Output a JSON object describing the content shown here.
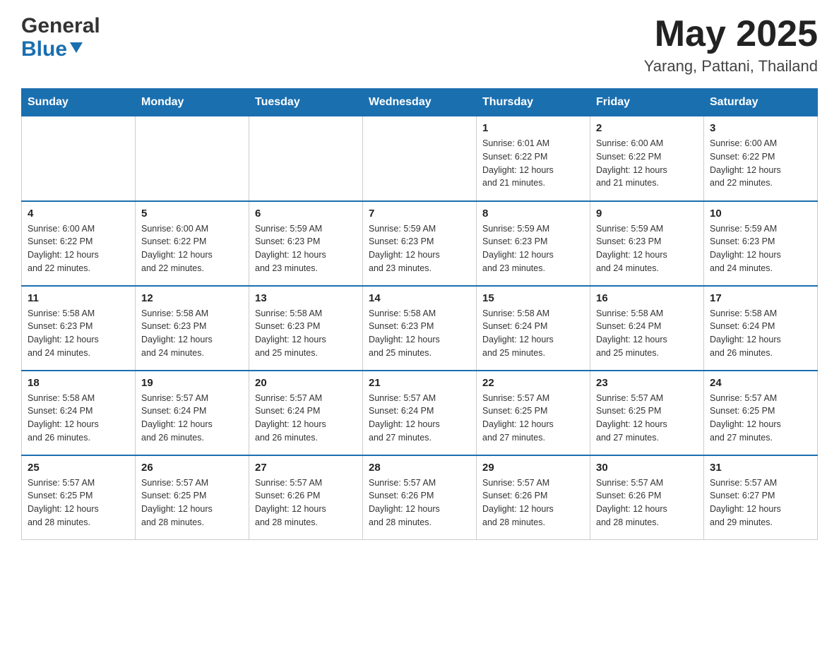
{
  "header": {
    "logo_general": "General",
    "logo_blue": "Blue",
    "month_title": "May 2025",
    "location": "Yarang, Pattani, Thailand"
  },
  "weekdays": [
    "Sunday",
    "Monday",
    "Tuesday",
    "Wednesday",
    "Thursday",
    "Friday",
    "Saturday"
  ],
  "weeks": [
    [
      {
        "day": "",
        "info": ""
      },
      {
        "day": "",
        "info": ""
      },
      {
        "day": "",
        "info": ""
      },
      {
        "day": "",
        "info": ""
      },
      {
        "day": "1",
        "info": "Sunrise: 6:01 AM\nSunset: 6:22 PM\nDaylight: 12 hours\nand 21 minutes."
      },
      {
        "day": "2",
        "info": "Sunrise: 6:00 AM\nSunset: 6:22 PM\nDaylight: 12 hours\nand 21 minutes."
      },
      {
        "day": "3",
        "info": "Sunrise: 6:00 AM\nSunset: 6:22 PM\nDaylight: 12 hours\nand 22 minutes."
      }
    ],
    [
      {
        "day": "4",
        "info": "Sunrise: 6:00 AM\nSunset: 6:22 PM\nDaylight: 12 hours\nand 22 minutes."
      },
      {
        "day": "5",
        "info": "Sunrise: 6:00 AM\nSunset: 6:22 PM\nDaylight: 12 hours\nand 22 minutes."
      },
      {
        "day": "6",
        "info": "Sunrise: 5:59 AM\nSunset: 6:23 PM\nDaylight: 12 hours\nand 23 minutes."
      },
      {
        "day": "7",
        "info": "Sunrise: 5:59 AM\nSunset: 6:23 PM\nDaylight: 12 hours\nand 23 minutes."
      },
      {
        "day": "8",
        "info": "Sunrise: 5:59 AM\nSunset: 6:23 PM\nDaylight: 12 hours\nand 23 minutes."
      },
      {
        "day": "9",
        "info": "Sunrise: 5:59 AM\nSunset: 6:23 PM\nDaylight: 12 hours\nand 24 minutes."
      },
      {
        "day": "10",
        "info": "Sunrise: 5:59 AM\nSunset: 6:23 PM\nDaylight: 12 hours\nand 24 minutes."
      }
    ],
    [
      {
        "day": "11",
        "info": "Sunrise: 5:58 AM\nSunset: 6:23 PM\nDaylight: 12 hours\nand 24 minutes."
      },
      {
        "day": "12",
        "info": "Sunrise: 5:58 AM\nSunset: 6:23 PM\nDaylight: 12 hours\nand 24 minutes."
      },
      {
        "day": "13",
        "info": "Sunrise: 5:58 AM\nSunset: 6:23 PM\nDaylight: 12 hours\nand 25 minutes."
      },
      {
        "day": "14",
        "info": "Sunrise: 5:58 AM\nSunset: 6:23 PM\nDaylight: 12 hours\nand 25 minutes."
      },
      {
        "day": "15",
        "info": "Sunrise: 5:58 AM\nSunset: 6:24 PM\nDaylight: 12 hours\nand 25 minutes."
      },
      {
        "day": "16",
        "info": "Sunrise: 5:58 AM\nSunset: 6:24 PM\nDaylight: 12 hours\nand 25 minutes."
      },
      {
        "day": "17",
        "info": "Sunrise: 5:58 AM\nSunset: 6:24 PM\nDaylight: 12 hours\nand 26 minutes."
      }
    ],
    [
      {
        "day": "18",
        "info": "Sunrise: 5:58 AM\nSunset: 6:24 PM\nDaylight: 12 hours\nand 26 minutes."
      },
      {
        "day": "19",
        "info": "Sunrise: 5:57 AM\nSunset: 6:24 PM\nDaylight: 12 hours\nand 26 minutes."
      },
      {
        "day": "20",
        "info": "Sunrise: 5:57 AM\nSunset: 6:24 PM\nDaylight: 12 hours\nand 26 minutes."
      },
      {
        "day": "21",
        "info": "Sunrise: 5:57 AM\nSunset: 6:24 PM\nDaylight: 12 hours\nand 27 minutes."
      },
      {
        "day": "22",
        "info": "Sunrise: 5:57 AM\nSunset: 6:25 PM\nDaylight: 12 hours\nand 27 minutes."
      },
      {
        "day": "23",
        "info": "Sunrise: 5:57 AM\nSunset: 6:25 PM\nDaylight: 12 hours\nand 27 minutes."
      },
      {
        "day": "24",
        "info": "Sunrise: 5:57 AM\nSunset: 6:25 PM\nDaylight: 12 hours\nand 27 minutes."
      }
    ],
    [
      {
        "day": "25",
        "info": "Sunrise: 5:57 AM\nSunset: 6:25 PM\nDaylight: 12 hours\nand 28 minutes."
      },
      {
        "day": "26",
        "info": "Sunrise: 5:57 AM\nSunset: 6:25 PM\nDaylight: 12 hours\nand 28 minutes."
      },
      {
        "day": "27",
        "info": "Sunrise: 5:57 AM\nSunset: 6:26 PM\nDaylight: 12 hours\nand 28 minutes."
      },
      {
        "day": "28",
        "info": "Sunrise: 5:57 AM\nSunset: 6:26 PM\nDaylight: 12 hours\nand 28 minutes."
      },
      {
        "day": "29",
        "info": "Sunrise: 5:57 AM\nSunset: 6:26 PM\nDaylight: 12 hours\nand 28 minutes."
      },
      {
        "day": "30",
        "info": "Sunrise: 5:57 AM\nSunset: 6:26 PM\nDaylight: 12 hours\nand 28 minutes."
      },
      {
        "day": "31",
        "info": "Sunrise: 5:57 AM\nSunset: 6:27 PM\nDaylight: 12 hours\nand 29 minutes."
      }
    ]
  ]
}
